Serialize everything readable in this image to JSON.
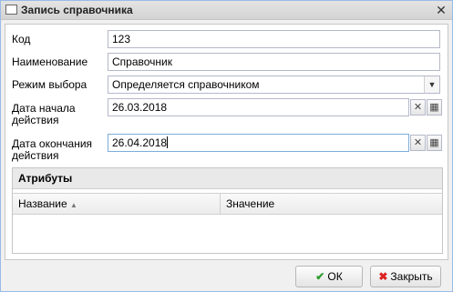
{
  "window": {
    "title": "Запись справочника"
  },
  "form": {
    "code": {
      "label": "Код",
      "value": "123"
    },
    "name": {
      "label": "Наименование",
      "value": "Справочник"
    },
    "mode": {
      "label": "Режим выбора",
      "value": "Определяется справочником"
    },
    "start_date": {
      "label_line1": "Дата начала",
      "label_line2": "действия",
      "value": "26.03.2018"
    },
    "end_date": {
      "label_line1": "Дата окончания",
      "label_line2": "действия",
      "value": "26.04.2018"
    }
  },
  "attributes": {
    "title": "Атрибуты",
    "columns": [
      {
        "label": "Название",
        "sort": "asc"
      },
      {
        "label": "Значение"
      }
    ],
    "rows": []
  },
  "footer": {
    "ok_label": "ОК",
    "close_label": "Закрыть"
  },
  "icons": {
    "ok": "checkmark-icon",
    "close": "x-icon",
    "calendar": "calendar-icon",
    "clear": "clear-icon"
  }
}
